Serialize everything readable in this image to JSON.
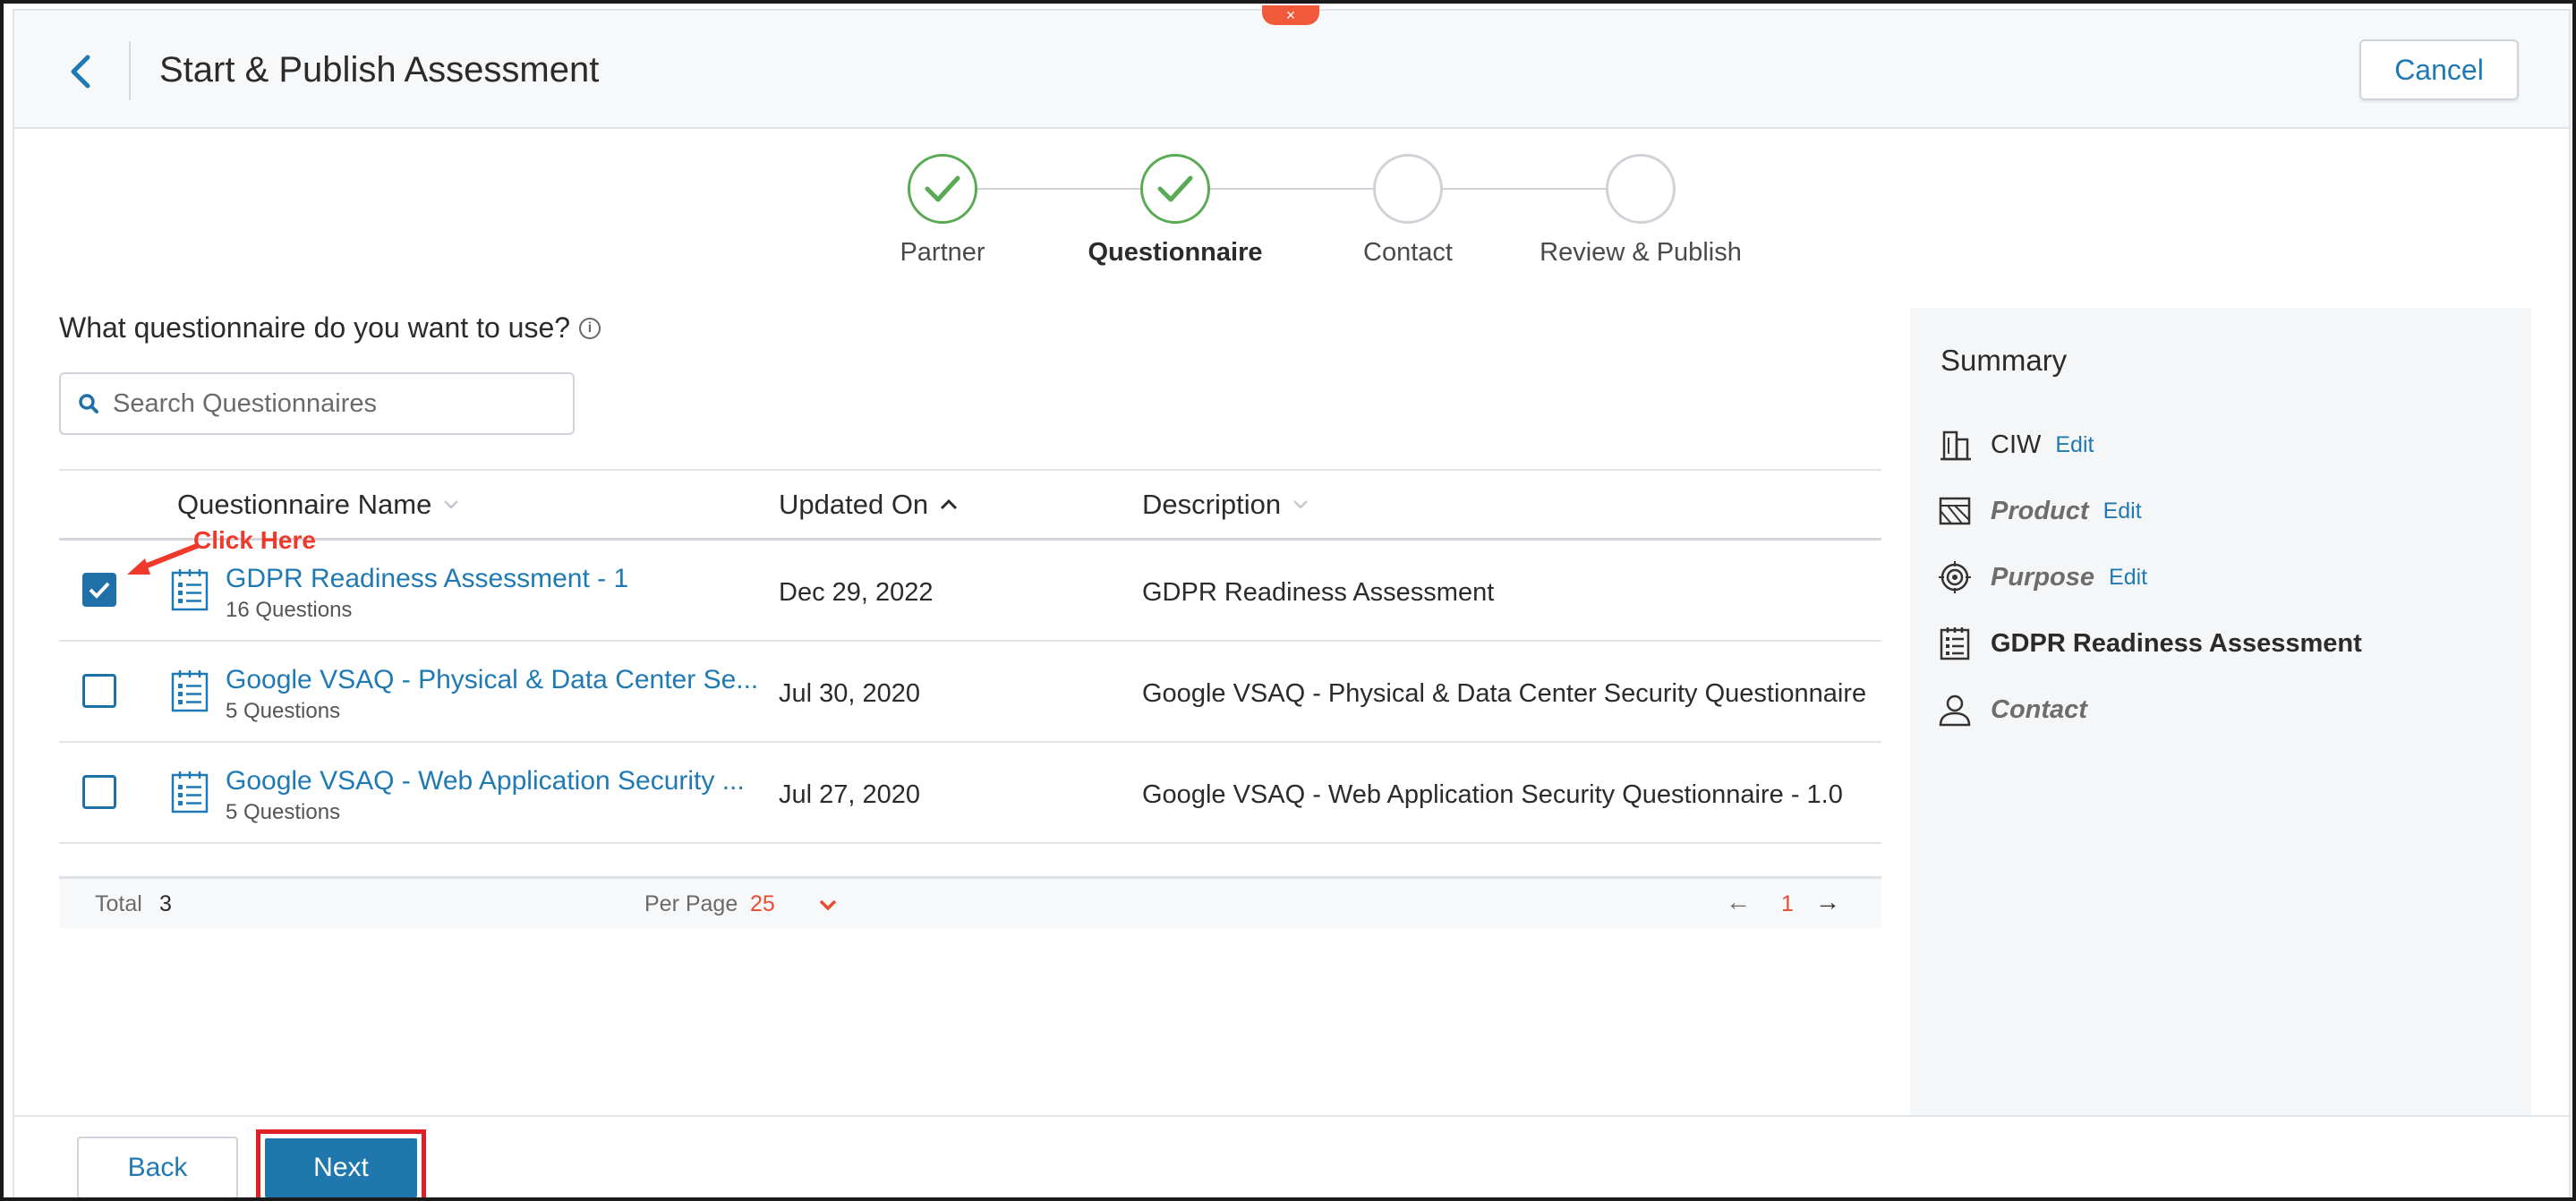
{
  "header": {
    "title": "Start & Publish Assessment",
    "cancel_label": "Cancel",
    "collapse_glyph": "×"
  },
  "stepper": {
    "steps": [
      {
        "label": "Partner",
        "state": "done"
      },
      {
        "label": "Questionnaire",
        "state": "done"
      },
      {
        "label": "Contact",
        "state": "pending"
      },
      {
        "label": "Review & Publish",
        "state": "pending"
      }
    ]
  },
  "question": {
    "text": "What questionnaire do you want to use?",
    "info_glyph": "i"
  },
  "search": {
    "placeholder": "Search Questionnaires"
  },
  "table": {
    "columns": [
      "Questionnaire Name",
      "Updated On",
      "Description"
    ],
    "rows": [
      {
        "name": "GDPR Readiness Assessment - 1",
        "count": "16 Questions",
        "updated": "Dec 29, 2022",
        "description": "GDPR Readiness Assessment",
        "checked": true
      },
      {
        "name": "Google VSAQ - Physical & Data Center Se...",
        "count": "5 Questions",
        "updated": "Jul 30, 2020",
        "description": "Google VSAQ - Physical & Data Center Security Questionnaire",
        "checked": false
      },
      {
        "name": "Google VSAQ - Web Application Security ...",
        "count": "5 Questions",
        "updated": "Jul 27, 2020",
        "description": "Google VSAQ - Web Application Security Questionnaire - 1.0",
        "checked": false
      }
    ],
    "footer": {
      "total_label": "Total",
      "total_value": "3",
      "per_page_label": "Per Page",
      "per_page_value": "25",
      "prev_glyph": "←",
      "page": "1",
      "next_glyph": "→"
    }
  },
  "annotation": {
    "click_here": "Click Here"
  },
  "summary": {
    "title": "Summary",
    "items": [
      {
        "text": "CIW",
        "edit": "Edit",
        "icon": "building-icon"
      },
      {
        "text": "Product",
        "edit": "Edit",
        "icon": "product-icon"
      },
      {
        "text": "Purpose",
        "edit": "Edit",
        "icon": "target-icon"
      },
      {
        "text": "GDPR Readiness Assessment",
        "icon": "questionnaire-icon"
      },
      {
        "text": "Contact",
        "icon": "person-icon"
      }
    ]
  },
  "bottom": {
    "back_label": "Back",
    "next_label": "Next"
  },
  "colors": {
    "accent": "#1f7ab3",
    "success": "#5aaa55",
    "highlight": "#e01f26"
  }
}
